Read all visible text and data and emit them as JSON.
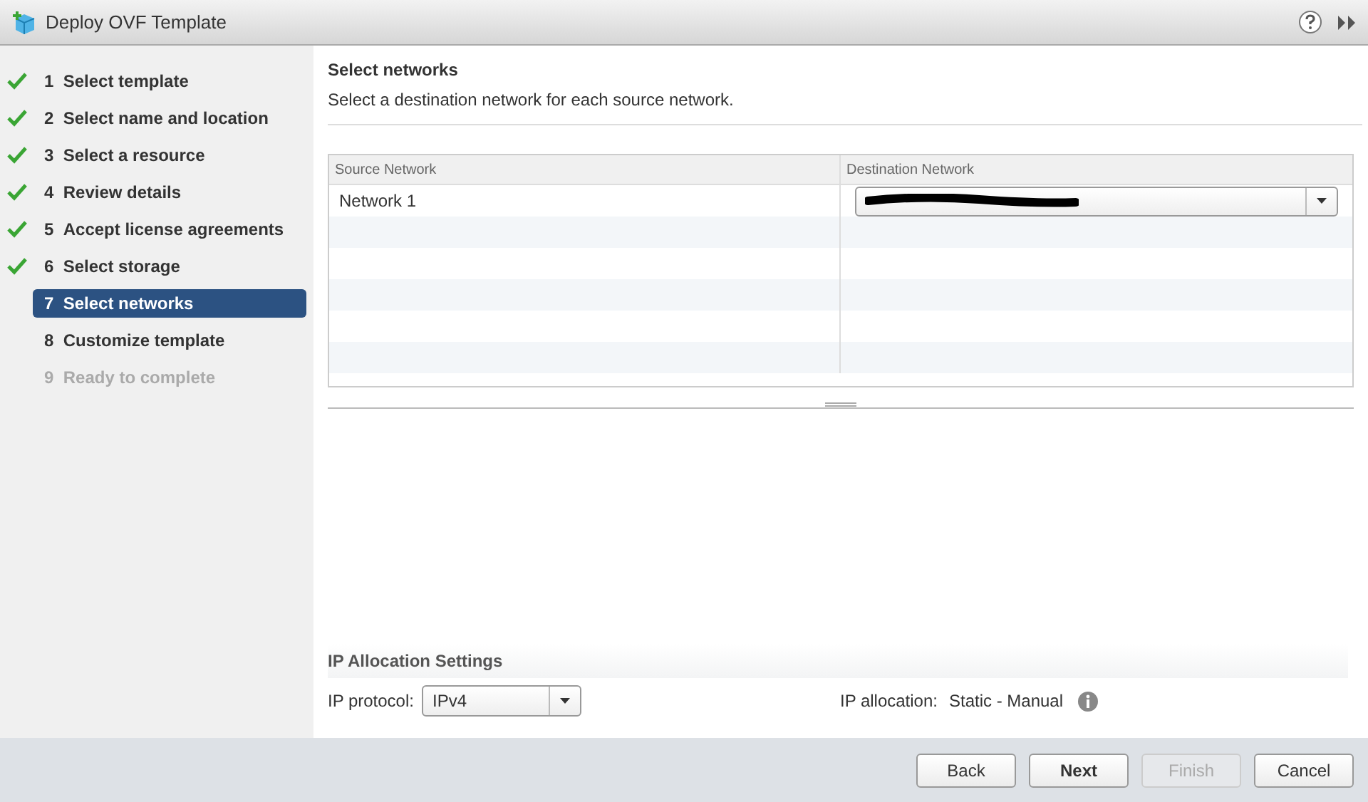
{
  "window": {
    "title": "Deploy OVF Template"
  },
  "steps": [
    {
      "number": "1",
      "label": "Select template",
      "done": true,
      "selected": false,
      "disabled": false
    },
    {
      "number": "2",
      "label": "Select name and location",
      "done": true,
      "selected": false,
      "disabled": false
    },
    {
      "number": "3",
      "label": "Select a resource",
      "done": true,
      "selected": false,
      "disabled": false
    },
    {
      "number": "4",
      "label": "Review details",
      "done": true,
      "selected": false,
      "disabled": false
    },
    {
      "number": "5",
      "label": "Accept license agreements",
      "done": true,
      "selected": false,
      "disabled": false
    },
    {
      "number": "6",
      "label": "Select storage",
      "done": true,
      "selected": false,
      "disabled": false
    },
    {
      "number": "7",
      "label": "Select networks",
      "done": false,
      "selected": true,
      "disabled": false
    },
    {
      "number": "8",
      "label": "Customize template",
      "done": false,
      "selected": false,
      "disabled": false
    },
    {
      "number": "9",
      "label": "Ready to complete",
      "done": false,
      "selected": false,
      "disabled": true
    }
  ],
  "page": {
    "title": "Select networks",
    "subtitle": "Select a destination network for each source network."
  },
  "table": {
    "columns": [
      "Source Network",
      "Destination Network"
    ],
    "rows": [
      {
        "source": "Network 1",
        "destination": {
          "kind": "dropdown",
          "redacted": true
        }
      }
    ]
  },
  "ip_settings": {
    "title": "IP Allocation Settings",
    "protocol_label": "IP protocol:",
    "protocol_value": "IPv4",
    "allocation_label": "IP allocation:",
    "allocation_value": "Static - Manual"
  },
  "buttons": [
    {
      "label": "Back",
      "primary": false,
      "disabled": false
    },
    {
      "label": "Next",
      "primary": true,
      "disabled": false
    },
    {
      "label": "Finish",
      "primary": false,
      "disabled": true
    },
    {
      "label": "Cancel",
      "primary": false,
      "disabled": false
    }
  ]
}
